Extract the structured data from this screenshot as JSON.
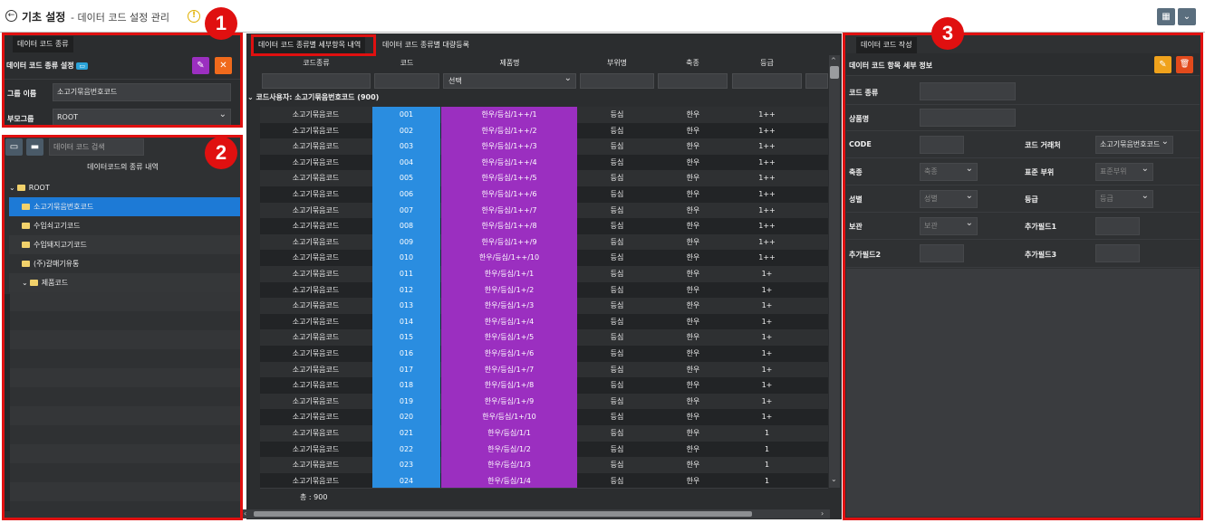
{
  "header": {
    "title": "기초 설정",
    "subtitle": "- 데이터 코드 설정 관리",
    "warn_symbol": "!",
    "btn_grid": "▦",
    "btn_dropdown": "⌄"
  },
  "left_top": {
    "tab": "데이터 코드 종류",
    "section_title": "데이터 코드 종류 설정",
    "section_badge": "▭",
    "btn_edit_icon": "✎",
    "btn_close_icon": "✕",
    "group_label": "그룹 이름",
    "group_value": "소고기묶음번호코드",
    "parent_label": "부모그룹",
    "parent_value": "ROOT"
  },
  "left_tree": {
    "search_placeholder": "데이터 코드 검색",
    "list_title": "데이터코드의 종류 내역",
    "items": [
      {
        "label": "ROOT",
        "level": 0,
        "expanded": true
      },
      {
        "label": "소고기묶음번호코드",
        "level": 1,
        "selected": true
      },
      {
        "label": "수입쇠고기코드",
        "level": 1
      },
      {
        "label": "수입돼지고기코드",
        "level": 1
      },
      {
        "label": "(주)갈매기유통",
        "level": 1
      },
      {
        "label": "제품코드",
        "level": 1,
        "expanded": true
      }
    ]
  },
  "middle": {
    "tabs": [
      "데이터 코드 종류별 세부항목 내역",
      "데이터 코드 종류별 대량등록"
    ],
    "columns": [
      "코드종류",
      "코드",
      "제품명",
      "부위명",
      "축종",
      "등급"
    ],
    "filter_select": "선택",
    "group_header": "코드사용자: 소고기묶음번호코드 (900)",
    "rows": [
      [
        "소고기묶음코드",
        "001",
        "한우/등심/1++/1",
        "등심",
        "한우",
        "1++"
      ],
      [
        "소고기묶음코드",
        "002",
        "한우/등심/1++/2",
        "등심",
        "한우",
        "1++"
      ],
      [
        "소고기묶음코드",
        "003",
        "한우/등심/1++/3",
        "등심",
        "한우",
        "1++"
      ],
      [
        "소고기묶음코드",
        "004",
        "한우/등심/1++/4",
        "등심",
        "한우",
        "1++"
      ],
      [
        "소고기묶음코드",
        "005",
        "한우/등심/1++/5",
        "등심",
        "한우",
        "1++"
      ],
      [
        "소고기묶음코드",
        "006",
        "한우/등심/1++/6",
        "등심",
        "한우",
        "1++"
      ],
      [
        "소고기묶음코드",
        "007",
        "한우/등심/1++/7",
        "등심",
        "한우",
        "1++"
      ],
      [
        "소고기묶음코드",
        "008",
        "한우/등심/1++/8",
        "등심",
        "한우",
        "1++"
      ],
      [
        "소고기묶음코드",
        "009",
        "한우/등심/1++/9",
        "등심",
        "한우",
        "1++"
      ],
      [
        "소고기묶음코드",
        "010",
        "한우/등심/1++/10",
        "등심",
        "한우",
        "1++"
      ],
      [
        "소고기묶음코드",
        "011",
        "한우/등심/1+/1",
        "등심",
        "한우",
        "1+"
      ],
      [
        "소고기묶음코드",
        "012",
        "한우/등심/1+/2",
        "등심",
        "한우",
        "1+"
      ],
      [
        "소고기묶음코드",
        "013",
        "한우/등심/1+/3",
        "등심",
        "한우",
        "1+"
      ],
      [
        "소고기묶음코드",
        "014",
        "한우/등심/1+/4",
        "등심",
        "한우",
        "1+"
      ],
      [
        "소고기묶음코드",
        "015",
        "한우/등심/1+/5",
        "등심",
        "한우",
        "1+"
      ],
      [
        "소고기묶음코드",
        "016",
        "한우/등심/1+/6",
        "등심",
        "한우",
        "1+"
      ],
      [
        "소고기묶음코드",
        "017",
        "한우/등심/1+/7",
        "등심",
        "한우",
        "1+"
      ],
      [
        "소고기묶음코드",
        "018",
        "한우/등심/1+/8",
        "등심",
        "한우",
        "1+"
      ],
      [
        "소고기묶음코드",
        "019",
        "한우/등심/1+/9",
        "등심",
        "한우",
        "1+"
      ],
      [
        "소고기묶음코드",
        "020",
        "한우/등심/1+/10",
        "등심",
        "한우",
        "1+"
      ],
      [
        "소고기묶음코드",
        "021",
        "한우/등심/1/1",
        "등심",
        "한우",
        "1"
      ],
      [
        "소고기묶음코드",
        "022",
        "한우/등심/1/2",
        "등심",
        "한우",
        "1"
      ],
      [
        "소고기묶음코드",
        "023",
        "한우/등심/1/3",
        "등심",
        "한우",
        "1"
      ],
      [
        "소고기묶음코드",
        "024",
        "한우/등심/1/4",
        "등심",
        "한우",
        "1"
      ]
    ],
    "total": "총 : 900"
  },
  "right": {
    "tab": "데이터 코드 작성",
    "section_title": "데이터 코드 항목 세부 정보",
    "btn_edit_icon": "✎",
    "btn_delete_icon": "🗑",
    "fields": {
      "code_type": "코드 종류",
      "product_name": "상품명",
      "code": "CODE",
      "vendor": "코드 거래처",
      "vendor_value": "소고기묶음번호코드",
      "species": "축종",
      "species_ph": "축종",
      "std_part": "표준 부위",
      "std_part_ph": "표준부위",
      "gender": "성별",
      "gender_ph": "성별",
      "grade": "등급",
      "grade_ph": "등급",
      "storage": "보관",
      "storage_ph": "보관",
      "extra1": "추가필드1",
      "extra2": "추가필드2",
      "extra3": "추가필드3"
    }
  },
  "annotations": [
    "1",
    "2",
    "3"
  ],
  "colors": {
    "accent_red": "#e01010",
    "code_blue": "#2a8de0",
    "product_purple": "#9b2fc0",
    "selected_row": "#1d7ad6",
    "btn_purple": "#9b2fc0",
    "btn_orange": "#f06a1c"
  }
}
